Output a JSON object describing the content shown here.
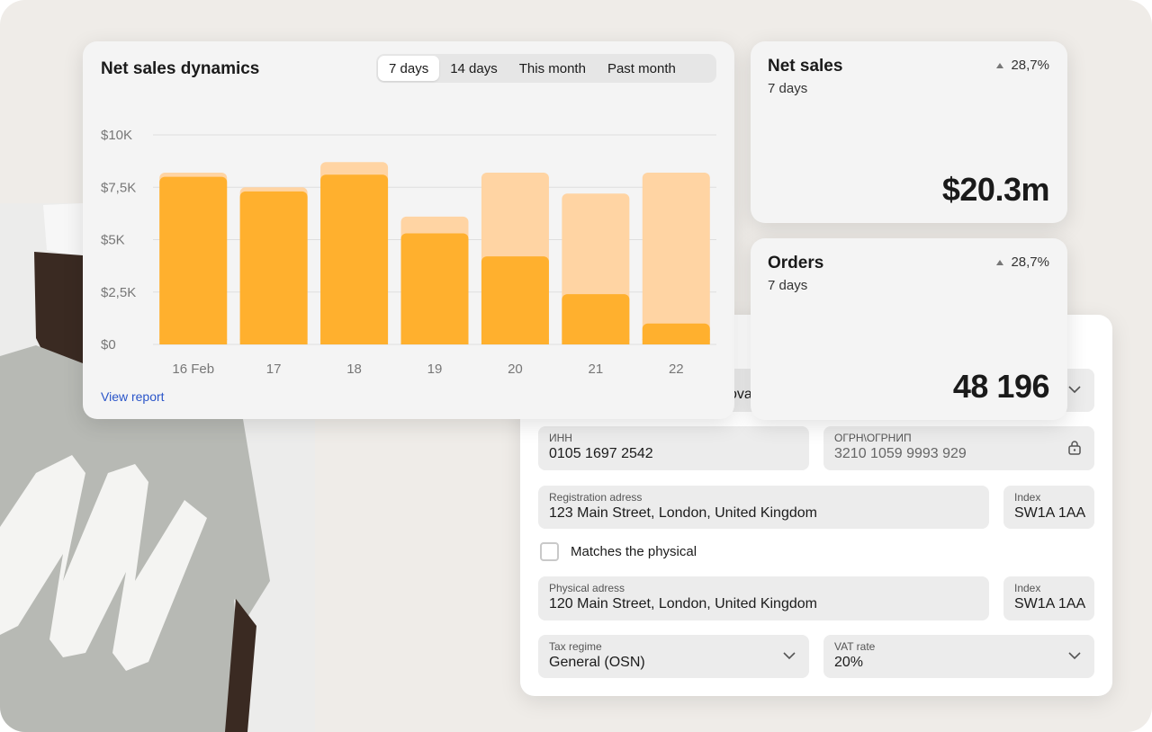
{
  "chart_card": {
    "title": "Net sales dynamics",
    "periods": [
      "7 days",
      "14 days",
      "This month",
      "Past month"
    ],
    "active_period": "7 days",
    "view_report": "View report"
  },
  "chart_data": {
    "type": "bar",
    "categories": [
      "16 Feb",
      "17",
      "18",
      "19",
      "20",
      "21",
      "22"
    ],
    "series": [
      {
        "values": [
          8000,
          7300,
          8100,
          5300,
          4200,
          2400,
          1000
        ]
      },
      {
        "values": [
          8200,
          7500,
          8700,
          6100,
          8200,
          7200,
          8200
        ]
      }
    ],
    "yticks": [
      "$10K",
      "$7,5K",
      "$5K",
      "$2,5K",
      "$0"
    ],
    "ylim": [
      0,
      10000
    ],
    "colors": {
      "primary": "#ffb02e",
      "secondary": "#ffd4a3"
    },
    "grid": true
  },
  "net_sales": {
    "title": "Net sales",
    "period": "7 days",
    "change": "28,7%",
    "value": "$20.3m"
  },
  "orders": {
    "title": "Orders",
    "period": "7 days",
    "change": "28,7%",
    "value": "48 196"
  },
  "form": {
    "hidden_fragment": "ova",
    "inn_label": "ИНН",
    "inn_value": "0105 1697 2542",
    "ogrn_label": "ОГРН\\ОГРНИП",
    "ogrn_value": "3210 1059 9993 929",
    "reg_label": "Registration adress",
    "reg_value": "123 Main Street, London, United Kingdom",
    "reg_index_label": "Index",
    "reg_index_value": "SW1A 1AA",
    "matches_label": "Matches the physical",
    "phys_label": "Physical adress",
    "phys_value": "120 Main Street, London, United Kingdom",
    "phys_index_label": "Index",
    "phys_index_value": "SW1A 1AA",
    "tax_label": "Tax regime",
    "tax_value": "General (OSN)",
    "vat_label": "VAT rate",
    "vat_value": "20%"
  }
}
